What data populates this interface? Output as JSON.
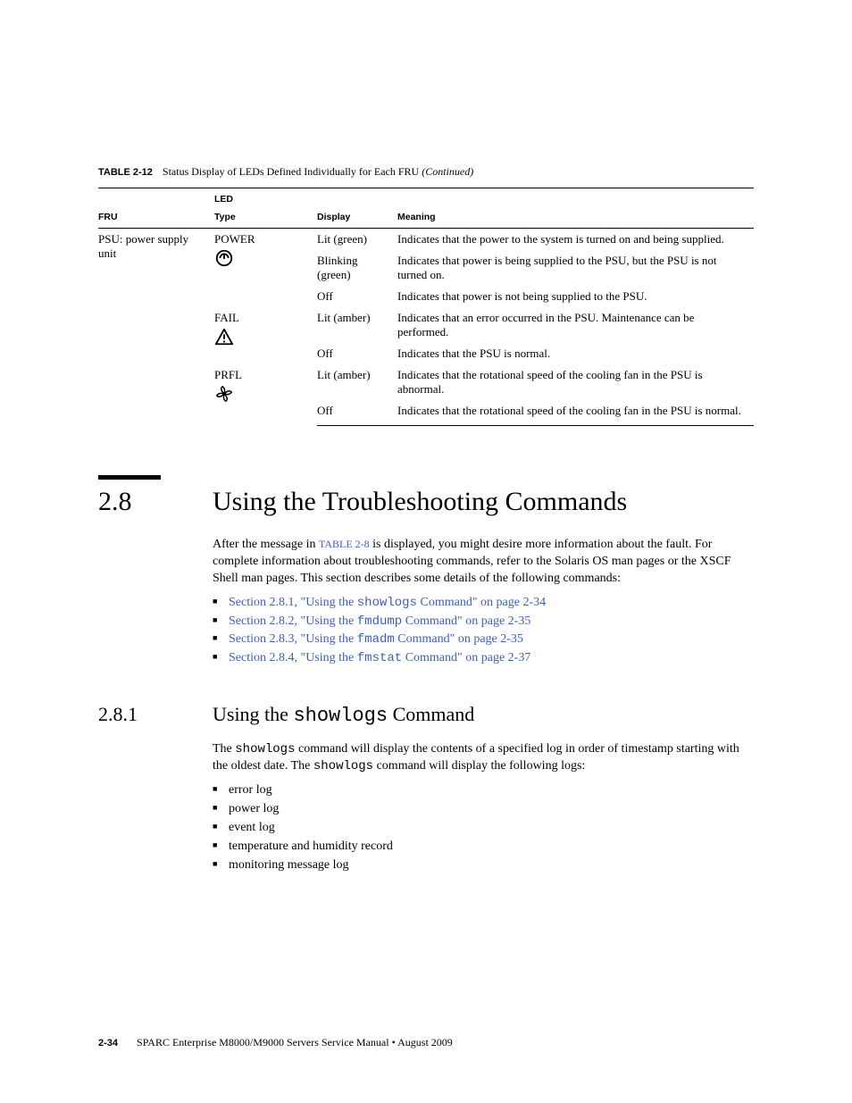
{
  "tableCaption": {
    "num": "TABLE 2-12",
    "title": "Status Display of LEDs Defined Individually for Each FRU",
    "cont": "(Continued)"
  },
  "headers": {
    "group": "LED",
    "fru": "FRU",
    "type": "Type",
    "display": "Display",
    "meaning": "Meaning"
  },
  "fruLabel": "PSU: power supply unit",
  "ledTypes": {
    "power": "POWER",
    "fail": "FAIL",
    "prfl": "PRFL"
  },
  "rows": {
    "powerLit": {
      "display": "Lit (green)",
      "meaning": "Indicates that the power to the system is turned on and being supplied."
    },
    "powerBlink": {
      "display": "Blinking (green)",
      "meaning": "Indicates that power is being supplied to the PSU, but the PSU is not turned on."
    },
    "powerOff": {
      "display": "Off",
      "meaning": "Indicates that power is not being supplied to the PSU."
    },
    "failLit": {
      "display": "Lit (amber)",
      "meaning": "Indicates that an error occurred in the PSU. Maintenance can be performed."
    },
    "failOff": {
      "display": "Off",
      "meaning": "Indicates that the PSU is normal."
    },
    "prflLit": {
      "display": "Lit (amber)",
      "meaning": "Indicates that the rotational speed of the cooling fan in the PSU is abnormal."
    },
    "prflOff": {
      "display": "Off",
      "meaning": "Indicates that the rotational speed of the cooling fan in the PSU is normal."
    }
  },
  "section": {
    "num": "2.8",
    "title": "Using the Troubleshooting Commands",
    "para1a": "After the message in ",
    "tableRef": "TABLE 2-8",
    "para1b": " is displayed, you might desire more information about the fault. For complete information about troubleshooting commands, refer to the Solaris OS man pages or the XSCF Shell man pages. This section describes some details of the following commands:",
    "links": {
      "l1a": "Section 2.8.1, \"Using the ",
      "l1cmd": "showlogs",
      "l1b": " Command\" on page 2-34",
      "l2a": "Section 2.8.2, \"Using the ",
      "l2cmd": "fmdump",
      "l2b": " Command\" on page 2-35",
      "l3a": "Section 2.8.3, \"Using the ",
      "l3cmd": "fmadm",
      "l3b": " Command\" on page 2-35",
      "l4a": "Section 2.8.4, \"Using the ",
      "l4cmd": "fmstat",
      "l4b": " Command\" on page 2-37"
    }
  },
  "subsection": {
    "num": "2.8.1",
    "titleA": "Using the ",
    "titleCmd": "showlogs",
    "titleB": " Command",
    "para1a": "The ",
    "cmd1": "showlogs",
    "para1b": " command will display the contents of a specified log in order of timestamp starting with the oldest date. The ",
    "cmd2": "showlogs",
    "para1c": " command will display the following logs:",
    "logs": {
      "i1": "error log",
      "i2": "power log",
      "i3": "event log",
      "i4": "temperature and humidity record",
      "i5": "monitoring message log"
    }
  },
  "footer": {
    "page": "2-34",
    "text": "SPARC Enterprise M8000/M9000 Servers Service Manual • August 2009"
  }
}
